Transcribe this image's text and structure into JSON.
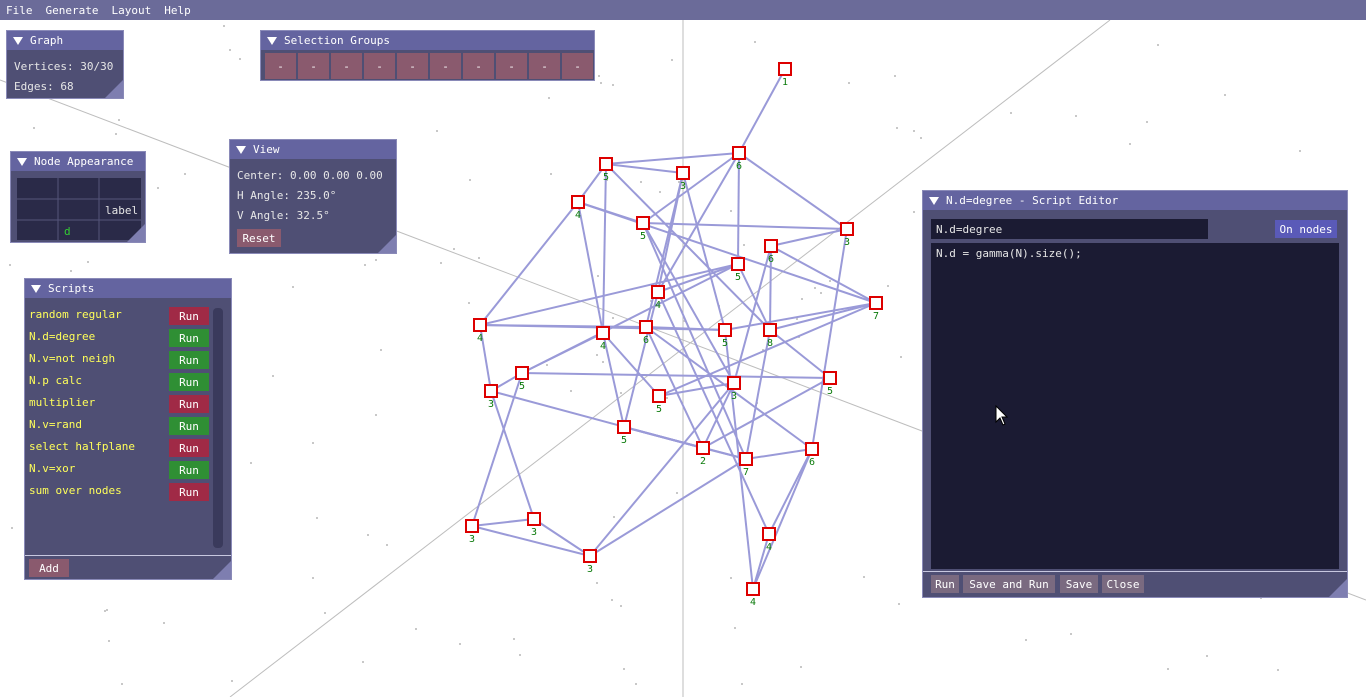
{
  "menu": [
    "File",
    "Generate",
    "Layout",
    "Help"
  ],
  "graph_window": {
    "title": "Graph",
    "vertices": "Vertices: 30/30",
    "edges": "Edges: 68"
  },
  "selection_groups": {
    "title": "Selection Groups",
    "cells": [
      "-",
      "-",
      "-",
      "-",
      "-",
      "-",
      "-",
      "-",
      "-",
      "-"
    ]
  },
  "node_appearance": {
    "title": "Node Appearance",
    "label_text": "label",
    "d_text": "d"
  },
  "view": {
    "title": "View",
    "center": "Center: 0.00 0.00 0.00",
    "h_angle": "H Angle: 235.0°",
    "v_angle": "V Angle: 32.5°",
    "reset": "Reset"
  },
  "scripts": {
    "title": "Scripts",
    "items": [
      {
        "name": "random regular",
        "run": "Run",
        "state": "red"
      },
      {
        "name": "N.d=degree",
        "run": "Run",
        "state": "green"
      },
      {
        "name": "N.v=not neigh",
        "run": "Run",
        "state": "green"
      },
      {
        "name": "N.p calc",
        "run": "Run",
        "state": "green"
      },
      {
        "name": "multiplier",
        "run": "Run",
        "state": "red"
      },
      {
        "name": "N.v=rand",
        "run": "Run",
        "state": "green"
      },
      {
        "name": "select halfplane",
        "run": "Run",
        "state": "red"
      },
      {
        "name": "N.v=xor",
        "run": "Run",
        "state": "green"
      },
      {
        "name": "sum over nodes",
        "run": "Run",
        "state": "red"
      }
    ],
    "add": "Add"
  },
  "editor": {
    "title": "N.d=degree - Script Editor",
    "name_value": "N.d=degree",
    "mode": "On nodes",
    "code": "N.d = gamma(N).size();",
    "buttons": {
      "run": "Run",
      "save_run": "Save and Run",
      "save": "Save",
      "close": "Close"
    }
  },
  "graph_labels": [
    "1",
    "6",
    "5",
    "3",
    "4",
    "5",
    "3",
    "6",
    "5",
    "7",
    "4",
    "6",
    "4",
    "5",
    "8",
    "4",
    "3",
    "5",
    "5",
    "3",
    "5",
    "3",
    "5",
    "7",
    "6",
    "3",
    "3",
    "4",
    "4",
    "2"
  ],
  "colors": {
    "edge": "#9a9ad8",
    "node_border": "#dd0000",
    "label": "#0a7a0a"
  }
}
